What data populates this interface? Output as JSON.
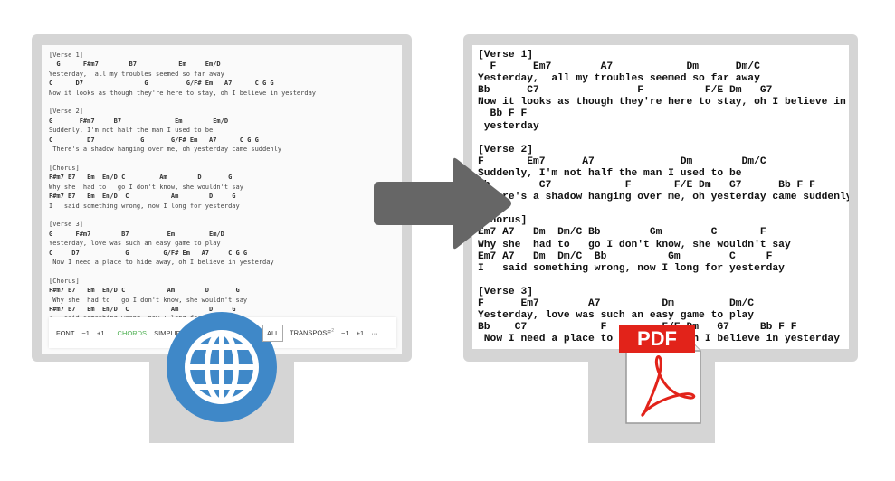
{
  "web_sheet": {
    "lines": [
      "[Verse 1]",
      "  G      F#m7        B7           Em     Em/D",
      "Yesterday,  all my troubles seemed so far away",
      "C      D7                G          G/F# Em   A7      C G G",
      "Now it looks as though they're here to stay, oh I believe in yesterday",
      "",
      "[Verse 2]",
      "G       F#m7     B7              Em        Em/D",
      "Suddenly, I'm not half the man I used to be",
      "C         D7            G       G/F# Em   A7      C G G",
      " There's a shadow hanging over me, oh yesterday came suddenly",
      "",
      "[Chorus]",
      "F#m7 B7   Em  Em/D C         Am        D       G",
      "Why she  had to   go I don't know, she wouldn't say",
      "F#m7 B7   Em  Em/D  C           Am        D     G",
      "I   said something wrong, now I long for yesterday",
      "",
      "[Verse 3]",
      "G      F#m7        B7          Em         Em/D",
      "Yesterday, love was such an easy game to play",
      "C     D7            G         G/F# Em   A7     C G G",
      " Now I need a place to hide away, oh I believe in yesterday",
      "",
      "[Chorus]",
      "F#m7 B7   Em  Em/D C           Am        D       G",
      " Why she  had to   go I don't know, she wouldn't say",
      "F#m7 B7   Em  Em/D  C           Am        D     G",
      "I   said something wrong, now I long for yesterday"
    ],
    "toolbar": {
      "font": "FONT",
      "minus": "−1",
      "plus": "+1",
      "chords": "CHORDS",
      "simplify": "SIMPLIFY",
      "all": "ALL",
      "transpose": "TRANSPOSE",
      "transpose_value": "2",
      "t_minus": "−1",
      "t_plus": "+1",
      "more": "···"
    }
  },
  "pdf_sheet": {
    "lines": [
      "[Verse 1]",
      "  F      Em7        A7            Dm      Dm/C",
      "Yesterday,  all my troubles seemed so far away",
      "Bb      C7                F          F/E Dm   G7",
      "Now it looks as though they're here to stay, oh I believe in",
      "  Bb F F",
      " yesterday",
      "",
      "[Verse 2]",
      "F       Em7      A7              Dm        Dm/C",
      "Suddenly, I'm not half the man I used to be",
      "Bb        C7            F       F/E Dm   G7      Bb F F",
      " There's a shadow hanging over me, oh yesterday came suddenly",
      "",
      "[Chorus]",
      "Em7 A7   Dm  Dm/C Bb        Gm        C       F",
      "Why she  had to   go I don't know, she wouldn't say",
      "Em7 A7   Dm  Dm/C  Bb          Gm        C     F",
      "I   said something wrong, now I long for yesterday",
      "",
      "[Verse 3]",
      "F      Em7        A7          Dm         Dm/C",
      "Yesterday, love was such an easy game to play",
      "Bb    C7            F         F/E Dm   G7     Bb F F",
      " Now I need a place to hide away, oh I believe in yesterday"
    ]
  },
  "pdf_label": "PDF",
  "colors": {
    "globe": "#3f88c8",
    "arrow": "#666666",
    "pdf_red": "#e2231a",
    "frame": "#d5d5d5"
  }
}
